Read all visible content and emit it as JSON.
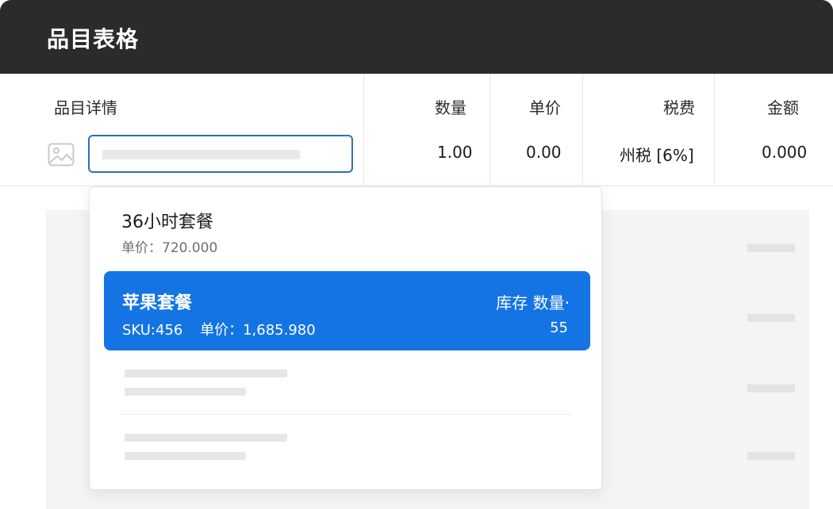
{
  "header": {
    "title": "品目表格"
  },
  "table": {
    "columns": [
      {
        "label": "品目详情"
      },
      {
        "label": "数量",
        "value": "1.00"
      },
      {
        "label": "单价",
        "value": "0.00"
      },
      {
        "label": "税费",
        "value": "州税 [6%]"
      },
      {
        "label": "金额",
        "value": "0.000"
      }
    ]
  },
  "dropdown": {
    "options": [
      {
        "name": "36小时套餐",
        "price_text": "单价：720.000"
      },
      {
        "name": "苹果套餐",
        "sku_text": "SKU:456",
        "price_text": "单价：1,685.980",
        "stock_label": "库存 数量·",
        "stock_value": "55"
      }
    ]
  },
  "icons": {
    "item_image": "image-placeholder-icon"
  },
  "colors": {
    "header_bg": "#2b2b2b",
    "accent": "#1474e4",
    "input_border": "#2f6fb5"
  }
}
